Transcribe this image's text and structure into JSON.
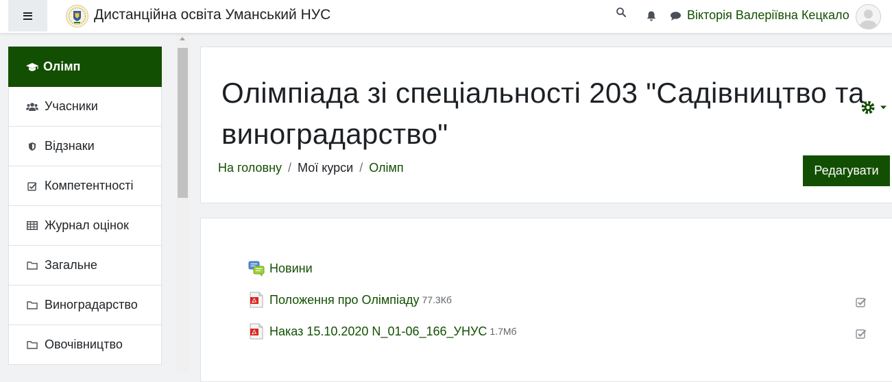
{
  "navbar": {
    "site_title": "Дистанційна освіта Уманський НУС",
    "user_name": "Вікторія Валеріївна Кецкало",
    "icons": [
      "menu-icon",
      "search-icon",
      "bell-icon",
      "chat-icon"
    ]
  },
  "sidebar": {
    "items": [
      {
        "label": "Олімп",
        "icon": "graduation-cap-icon",
        "active": true
      },
      {
        "label": "Учасники",
        "icon": "users-icon"
      },
      {
        "label": "Відзнаки",
        "icon": "shield-icon"
      },
      {
        "label": "Компетентності",
        "icon": "checkbox-icon"
      },
      {
        "label": "Журнал оцінок",
        "icon": "table-icon"
      },
      {
        "label": "Загальне",
        "icon": "folder-icon"
      },
      {
        "label": "Виноградарство",
        "icon": "folder-icon"
      },
      {
        "label": "Овочівництво",
        "icon": "folder-icon"
      }
    ]
  },
  "header": {
    "title": "Олімпіада зі спеціальності 203 \"Садівництво та виноградарство\"",
    "breadcrumb": [
      {
        "label": "На головну",
        "link": true
      },
      {
        "label": "Мої курси",
        "link": false
      },
      {
        "label": "Олімп",
        "link": true
      }
    ],
    "edit_button": "Редагувати"
  },
  "activities": [
    {
      "name": "Новини",
      "size": "",
      "type": "forum",
      "completion": false
    },
    {
      "name": "Положення про Олімпіаду",
      "size": "77.3Кб",
      "type": "pdf",
      "completion": true
    },
    {
      "name": "Наказ 15.10.2020 N_01-06_166_УНУС",
      "size": "1.7Мб",
      "type": "pdf",
      "completion": true
    }
  ],
  "colors": {
    "brand": "#134f02",
    "page_bg": "#f0f2f3",
    "text": "#1d2125"
  }
}
